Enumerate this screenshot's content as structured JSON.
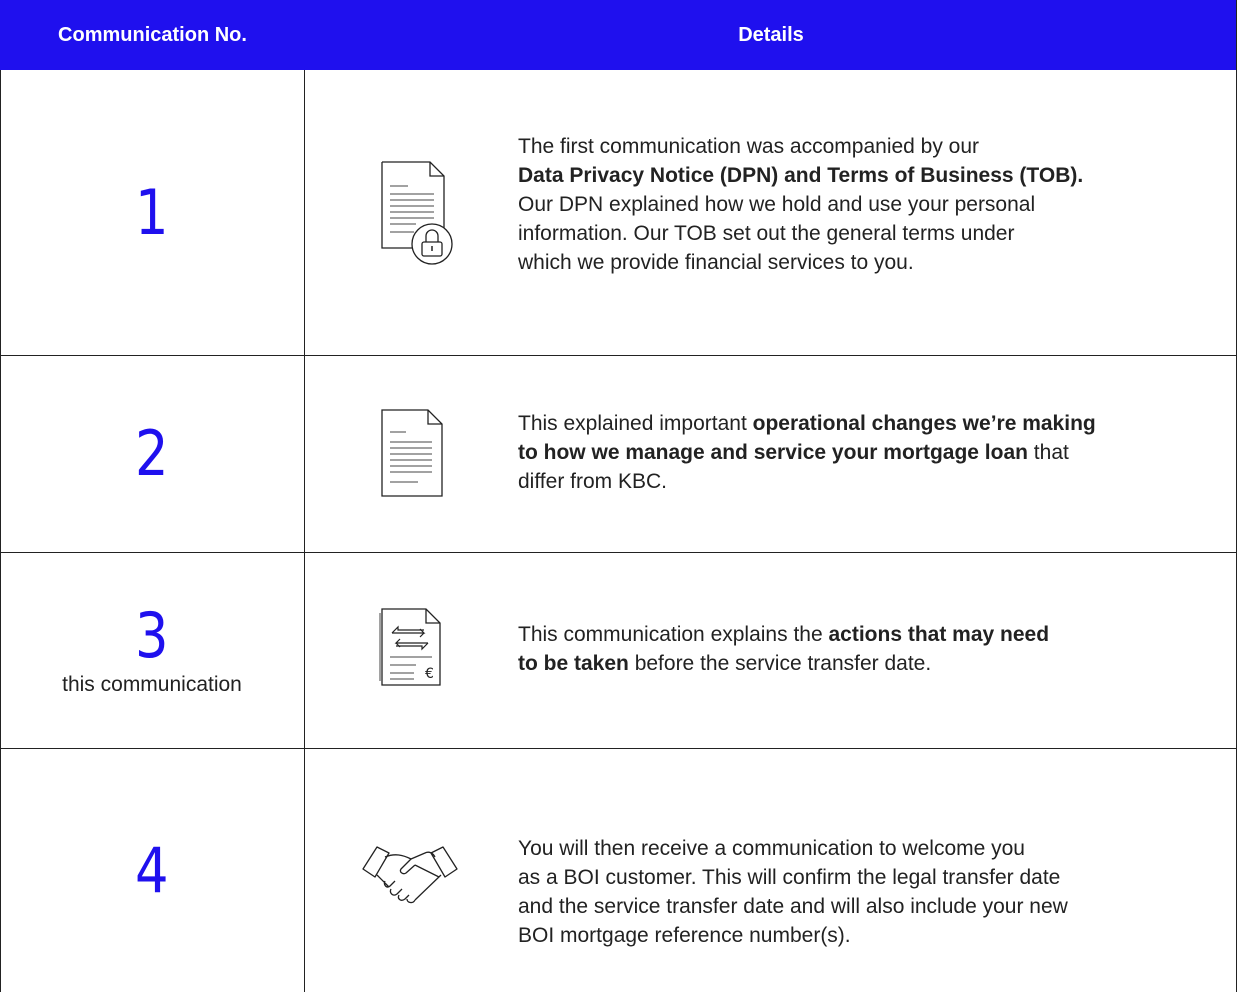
{
  "header": {
    "col1": "Communication No.",
    "col2": "Details"
  },
  "rows": [
    {
      "number": "1",
      "icon": "document-lock-icon",
      "lines": [
        {
          "t": "The first communication was accompanied by our"
        },
        {
          "b": "Data Privacy Notice (DPN) and Terms of Business (TOB)."
        },
        {
          "t": "Our DPN explained how we hold and use your personal"
        },
        {
          "t": "information. Our TOB set out the general terms under"
        },
        {
          "t": "which we provide financial services to you."
        }
      ]
    },
    {
      "number": "2",
      "icon": "document-icon",
      "lines": [
        {
          "t": "This explained important ",
          "b": "operational changes we’re making"
        },
        {
          "b": "to how we manage and service your mortgage loan",
          "t2": " that"
        },
        {
          "t": "differ from KBC."
        }
      ]
    },
    {
      "number": "3",
      "subtitle": "this communication",
      "icon": "document-transfer-euro-icon",
      "lines": [
        {
          "t": "This communication explains the ",
          "b": "actions that may need"
        },
        {
          "b": "to be taken",
          "t2": " before the service transfer date."
        }
      ]
    },
    {
      "number": "4",
      "icon": "handshake-icon",
      "lines": [
        {
          "t": "You will then receive a communication to welcome you"
        },
        {
          "t": "as a BOI customer. This will confirm the legal transfer date"
        },
        {
          "t": "and the service transfer date and will also include your new"
        },
        {
          "t": "BOI mortgage reference number(s)."
        }
      ]
    }
  ]
}
